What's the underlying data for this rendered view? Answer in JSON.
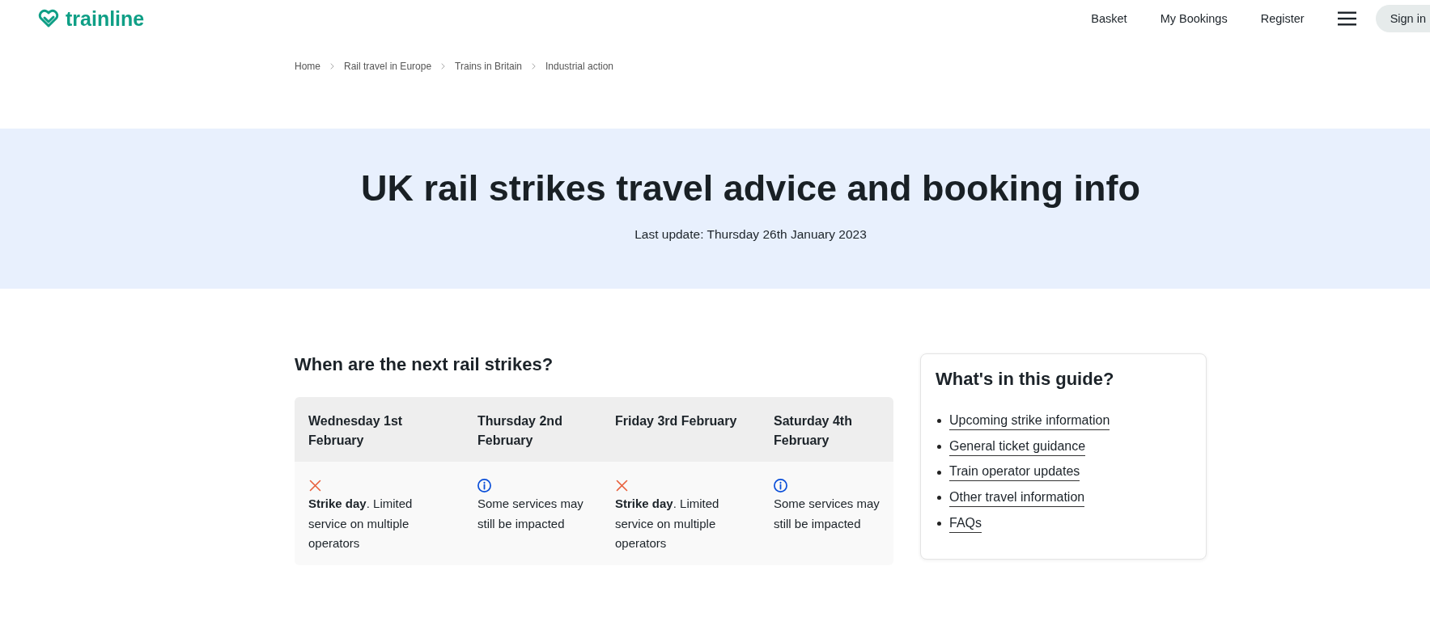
{
  "header": {
    "logo": "trainline",
    "nav": [
      "Basket",
      "My Bookings",
      "Register"
    ],
    "sign_in": "Sign in"
  },
  "breadcrumb": [
    "Home",
    "Rail travel in Europe",
    "Trains in Britain",
    "Industrial action"
  ],
  "hero": {
    "title": "UK rail strikes travel advice and booking info",
    "last_update": "Last update: Thursday 26th January 2023"
  },
  "strikes": {
    "heading": "When are the next rail strikes?",
    "days": [
      {
        "date": "Wednesday 1st February",
        "kind": "strike",
        "status": "**Strike day**. Limited service on multiple operators"
      },
      {
        "date": "Thursday 2nd February",
        "kind": "info",
        "status": "Some services may still be impacted"
      },
      {
        "date": "Friday 3rd February",
        "kind": "strike",
        "status": "**Strike day**. Limited service on multiple operators"
      },
      {
        "date": "Saturday 4th February",
        "kind": "info",
        "status": "Some services may still be impacted"
      }
    ]
  },
  "guide": {
    "title": "What's in this guide?",
    "links": [
      "Upcoming strike information",
      "General ticket guidance",
      "Train operator updates",
      "Other travel information",
      "FAQs"
    ]
  }
}
